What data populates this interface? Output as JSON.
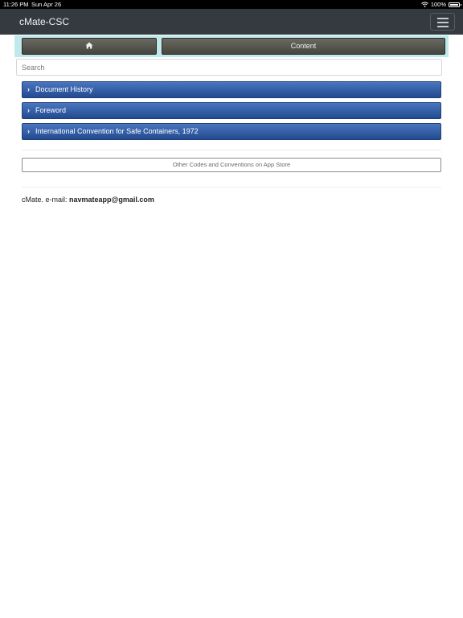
{
  "status_bar": {
    "time": "11:26 PM",
    "date": "Sun Apr 26",
    "battery": "100%"
  },
  "navbar": {
    "brand": "cMate-CSC"
  },
  "toolbar": {
    "home_icon": "home-icon",
    "content_label": "Content"
  },
  "search": {
    "placeholder": "Search"
  },
  "contents": {
    "items": [
      {
        "label": "Document History"
      },
      {
        "label": "Foreword"
      },
      {
        "label": "International Convention for Safe Containers, 1972"
      }
    ]
  },
  "store_button": {
    "label": "Other Codes and Conventions on App Store"
  },
  "footer": {
    "prefix": "cMate. e-mail:",
    "email": "navmateapp@gmail.com"
  },
  "colors": {
    "navbar": "#343a40",
    "accent_strip": "#bfe9ea",
    "item_blue": "#2f5aa6"
  }
}
